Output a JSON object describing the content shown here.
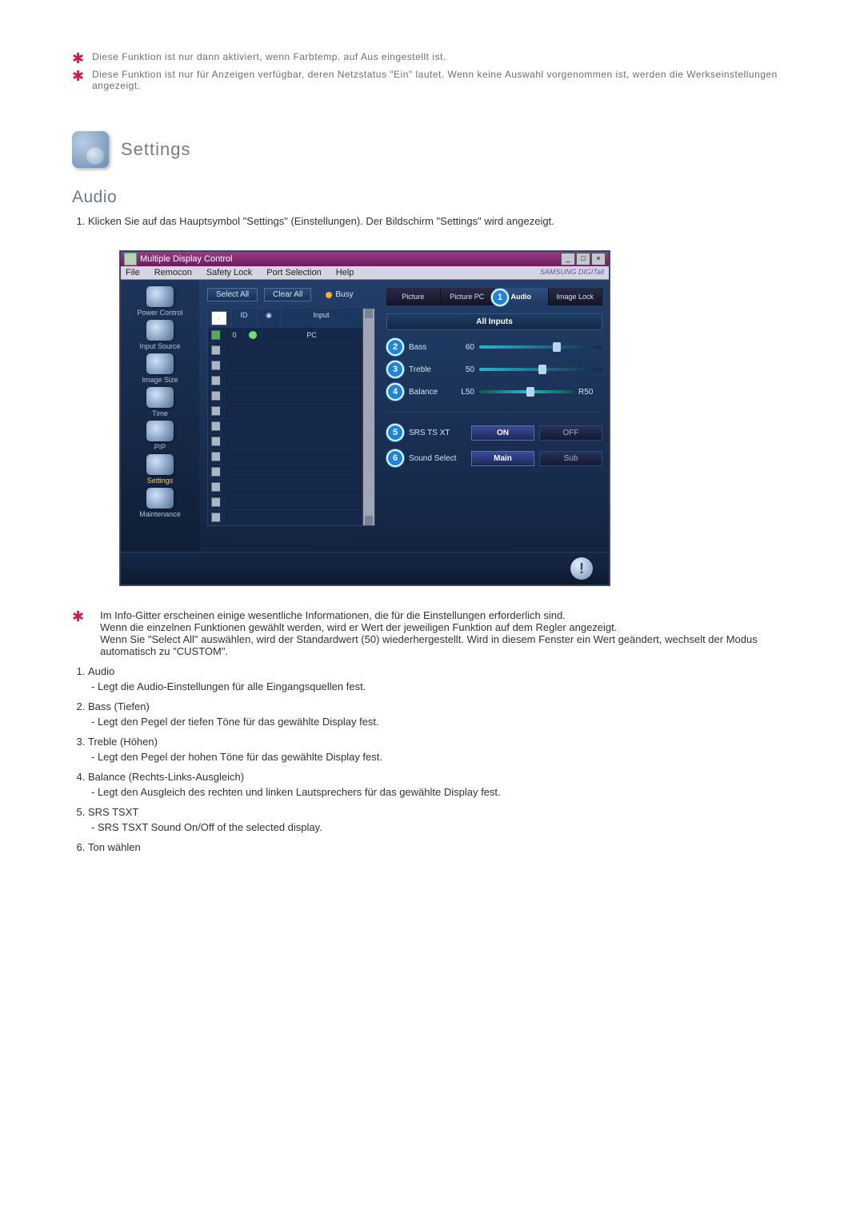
{
  "top_notes": [
    "Diese Funktion ist nur dann aktiviert, wenn Farbtemp. auf Aus eingestellt ist.",
    "Diese Funktion ist nur für Anzeigen verfügbar, deren Netzstatus \"Ein\" lautet. Wenn keine Auswahl vorgenommen ist, werden die Werkseinstellungen angezeigt."
  ],
  "icon_heading": "Settings",
  "section_heading": "Audio",
  "intro_1": "Klicken Sie auf das Hauptsymbol \"Settings\" (Einstellungen). Der Bildschirm \"Settings\" wird angezeigt.",
  "mdc": {
    "title": "Multiple Display Control",
    "menu": [
      "File",
      "Remocon",
      "Safety Lock",
      "Port Selection",
      "Help"
    ],
    "brand": "SAMSUNG DIGITall",
    "sidebar": [
      {
        "label": "Power Control",
        "sel": false
      },
      {
        "label": "Input Source",
        "sel": false
      },
      {
        "label": "Image Size",
        "sel": false
      },
      {
        "label": "Time",
        "sel": false
      },
      {
        "label": "PIP",
        "sel": false
      },
      {
        "label": "Settings",
        "sel": true
      },
      {
        "label": "Maintenance",
        "sel": false
      }
    ],
    "btn_select_all": "Select All",
    "btn_clear_all": "Clear All",
    "busy": "Busy",
    "grid_headers": {
      "id": "ID",
      "input": "Input"
    },
    "grid_rows": [
      {
        "id": "0",
        "input": "PC"
      }
    ],
    "tabs": [
      "Picture",
      "Picture PC",
      "Audio",
      "Image Lock"
    ],
    "active_tab_index": 2,
    "circle_in_tab": "1",
    "all_inputs": "All Inputs",
    "sliders": [
      {
        "num": "2",
        "label": "Bass",
        "value": "60",
        "thumb": 60
      },
      {
        "num": "3",
        "label": "Treble",
        "value": "50",
        "thumb": 48
      },
      {
        "num": "4",
        "label": "Balance",
        "value_l": "L50",
        "value_r": "R50",
        "thumb": 50,
        "balance": true
      }
    ],
    "btnrows": [
      {
        "num": "5",
        "label": "SRS TS XT",
        "b1": "ON",
        "b2": "OFF"
      },
      {
        "num": "6",
        "label": "Sound Select",
        "b1": "Main",
        "b2": "Sub"
      }
    ]
  },
  "explain_note": "Im Info-Gitter erscheinen einige wesentliche Informationen, die für die Einstellungen erforderlich sind.\nWenn die einzelnen Funktionen gewählt werden, wird er Wert der jeweiligen Funktion auf dem Regler angezeigt.\nWenn Sie \"Select All\" auswählen, wird der Standardwert (50) wiederhergestellt. Wird in diesem Fenster ein Wert geändert, wechselt der Modus automatisch zu \"CUSTOM\".",
  "items": [
    {
      "t": "Audio",
      "d": "- Legt die Audio-Einstellungen für alle Eingangsquellen fest."
    },
    {
      "t": "Bass (Tiefen)",
      "d": "- Legt den Pegel der tiefen Töne für das gewählte Display fest."
    },
    {
      "t": "Treble (Höhen)",
      "d": "- Legt den Pegel der hohen Töne für das gewählte Display fest."
    },
    {
      "t": "Balance (Rechts-Links-Ausgleich)",
      "d": "- Legt den Ausgleich des rechten und linken Lautsprechers für das gewählte Display fest."
    },
    {
      "t": "SRS TSXT",
      "d": "- SRS TSXT Sound On/Off of the selected display."
    },
    {
      "t": "Ton wählen",
      "d": ""
    }
  ]
}
